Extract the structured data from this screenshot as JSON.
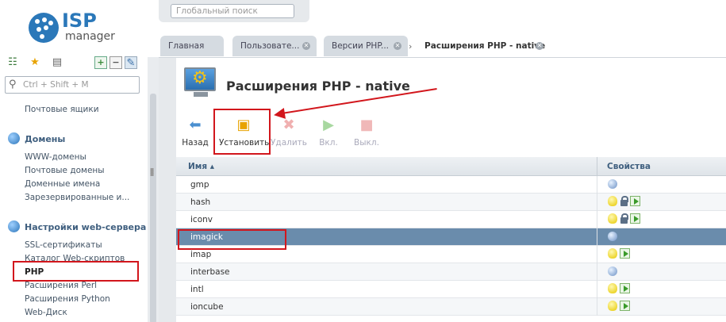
{
  "logo": {
    "brand": "ISP",
    "product": "manager"
  },
  "sidebar": {
    "search_placeholder": "Ctrl + Shift + M",
    "items": {
      "mailboxes": "Почтовые ящики",
      "domains_header": "Домены",
      "www_domains": "WWW-домены",
      "mail_domains": "Почтовые домены",
      "domain_names": "Доменные имена",
      "reserved": "Зарезервированные и...",
      "webserver_header": "Настройки web-сервера",
      "ssl": "SSL-сертификаты",
      "scripts": "Каталог Web-скриптов",
      "php": "PHP",
      "perl": "Расширения Perl",
      "python": "Расширения Python",
      "webdisk": "Web-Диск"
    }
  },
  "global_search": {
    "placeholder": "Глобальный поиск"
  },
  "tabs": [
    {
      "label": "Главная"
    },
    {
      "label": "Пользовате..."
    },
    {
      "label": "Версии PHP..."
    },
    {
      "label": "Расширения PHP - native"
    }
  ],
  "page": {
    "title": "Расширения PHP - native"
  },
  "toolbar": {
    "back": "Назад",
    "install": "Установить",
    "delete": "Удалить",
    "on": "Вкл.",
    "off": "Выкл."
  },
  "grid": {
    "columns": {
      "name": "Имя",
      "props": "Свойства"
    },
    "rows": [
      {
        "name": "gmp",
        "props": [
          "globe"
        ]
      },
      {
        "name": "hash",
        "props": [
          "bulb",
          "lock",
          "play"
        ]
      },
      {
        "name": "iconv",
        "props": [
          "bulb",
          "lock",
          "play"
        ]
      },
      {
        "name": "imagick",
        "props": [
          "globe"
        ],
        "selected": true
      },
      {
        "name": "imap",
        "props": [
          "bulb",
          "play"
        ]
      },
      {
        "name": "interbase",
        "props": [
          "globe"
        ]
      },
      {
        "name": "intl",
        "props": [
          "bulb",
          "play"
        ]
      },
      {
        "name": "ioncube",
        "props": [
          "bulb",
          "play"
        ]
      }
    ]
  },
  "colors": {
    "accent": "#2b78b9",
    "highlight": "#d2161c",
    "selected_row": "#6a8cac"
  }
}
